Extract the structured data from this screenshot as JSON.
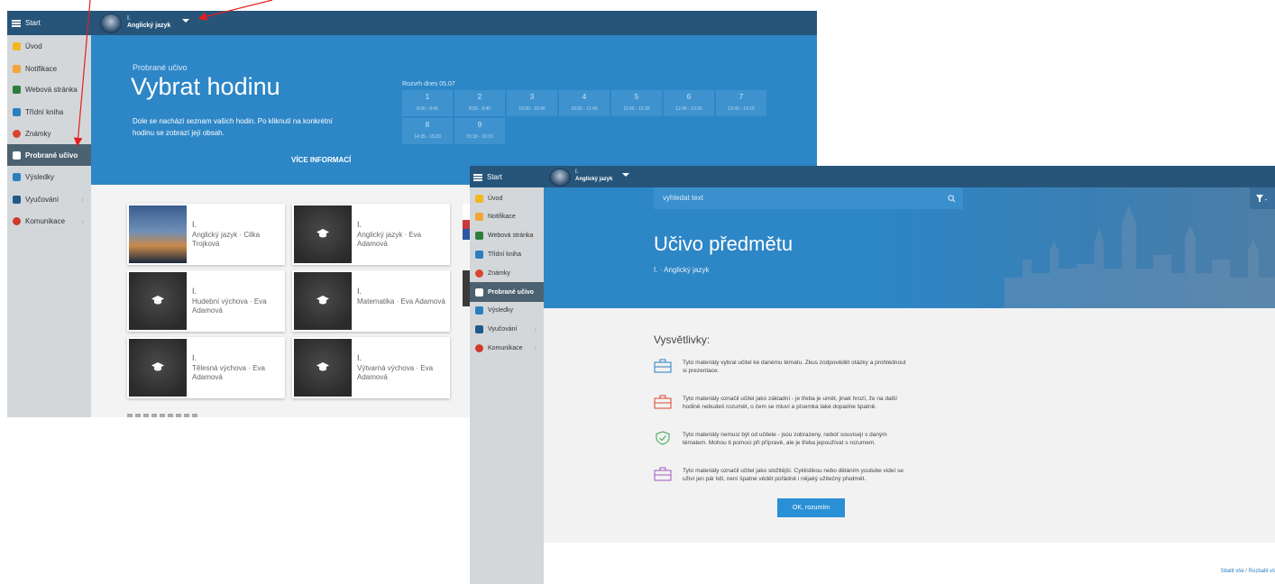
{
  "window1": {
    "start_label": "Start",
    "subject_line1": "I.",
    "subject_line2": "Anglický jazyk",
    "sidebar": [
      {
        "label": "Úvod"
      },
      {
        "label": "Notifikace"
      },
      {
        "label": "Webová stránka"
      },
      {
        "label": "Třídní kniha"
      },
      {
        "label": "Známky"
      },
      {
        "label": "Probrané učivo"
      },
      {
        "label": "Výsledky"
      },
      {
        "label": "Vyučování"
      },
      {
        "label": "Komunikace"
      }
    ],
    "hero": {
      "kicker": "Probrané učivo",
      "title": "Vybrat hodinu",
      "desc_line1": "Dole se nachází seznam vašich hodin. Po kliknutí na konkrétní",
      "desc_line2": "hodinu se zobrazí její obsah.",
      "more_link": "VÍCE INFORMACÍ",
      "timetable_title": "Rozvrh dnes 05.07",
      "timetable": [
        {
          "n": "1",
          "t": "8:00 - 8:45"
        },
        {
          "n": "2",
          "t": "8:55 - 9:40"
        },
        {
          "n": "3",
          "t": "10:00 - 10:45"
        },
        {
          "n": "4",
          "t": "10:55 - 11:40"
        },
        {
          "n": "5",
          "t": "11:50 - 12:35"
        },
        {
          "n": "6",
          "t": "12:45 - 13:30"
        },
        {
          "n": "7",
          "t": "13:40 - 14:25"
        },
        {
          "n": "8",
          "t": "14:35 - 15:20"
        },
        {
          "n": "9",
          "t": "15:30 - 16:15"
        }
      ]
    },
    "cards": [
      {
        "l1": "I.",
        "l2": "Anglický jazyk · Cilka Trojková"
      },
      {
        "l1": "I.",
        "l2": "Anglický jazyk · Eva Adamová"
      },
      {
        "l1": "I.",
        "l2": "Hudební výchova · Eva Adamová"
      },
      {
        "l1": "I.",
        "l2": "Matematika · Eva Adamová"
      },
      {
        "l1": "I.",
        "l2": "Tělesná výchova · Eva Adamová"
      },
      {
        "l1": "I.",
        "l2": "Výtvarná výchova · Eva Adamová"
      }
    ]
  },
  "window2": {
    "start_label": "Start",
    "subject_line1": "I.",
    "subject_line2": "Anglický jazyk",
    "sidebar": [
      {
        "label": "Úvod"
      },
      {
        "label": "Notifikace"
      },
      {
        "label": "Webová stránka"
      },
      {
        "label": "Třídní kniha"
      },
      {
        "label": "Známky"
      },
      {
        "label": "Probrané učivo"
      },
      {
        "label": "Výsledky"
      },
      {
        "label": "Vyučování"
      },
      {
        "label": "Komunikace"
      }
    ],
    "search_placeholder": "vyhledat text",
    "hero_title": "Učivo předmětu",
    "hero_sub": "I. · Anglický jazyk",
    "legend_title": "Vysvětlivky:",
    "legend": [
      {
        "line1": "Tyto materiály vybral učitel ke danému tématu. Zkus zodpovědět otázky a prohlédnout",
        "line2": "si prezentace."
      },
      {
        "line1": "Tyto materiály označil učitel jako základní - je třeba je umět, jinak hrozí, že na další",
        "line2": "hodině nebudeš rozumět, o čem se mluví a písemka také dopadne špatně."
      },
      {
        "line1": "Tyto materiály nemusí být od učitele - jsou zobrazeny, neboť souvisejí s daným",
        "line2": "tématem. Mohou ti pomoci při přípravě, ale je třeba jepoužívat s rozumem."
      },
      {
        "line1": "Tyto materiály označil učitel jako složitější. Cyklistikou nebo děláním youtube videí se",
        "line2": "uživí jen pár lidí, není špatné vědět pořádně i nějaký užitečný předmět."
      }
    ],
    "ok_button": "OK, rozumím",
    "footer_collapse": "Sbalit vše",
    "footer_sep": " / ",
    "footer_expand": "Rozbalit vš"
  },
  "colors": {
    "topbar": "#27557a",
    "hero_blue": "#2d86c6",
    "sidebar_bg": "#d3d7da",
    "sidebar_active": "#4c6270",
    "annotation_arrow": "#e41e1e"
  }
}
